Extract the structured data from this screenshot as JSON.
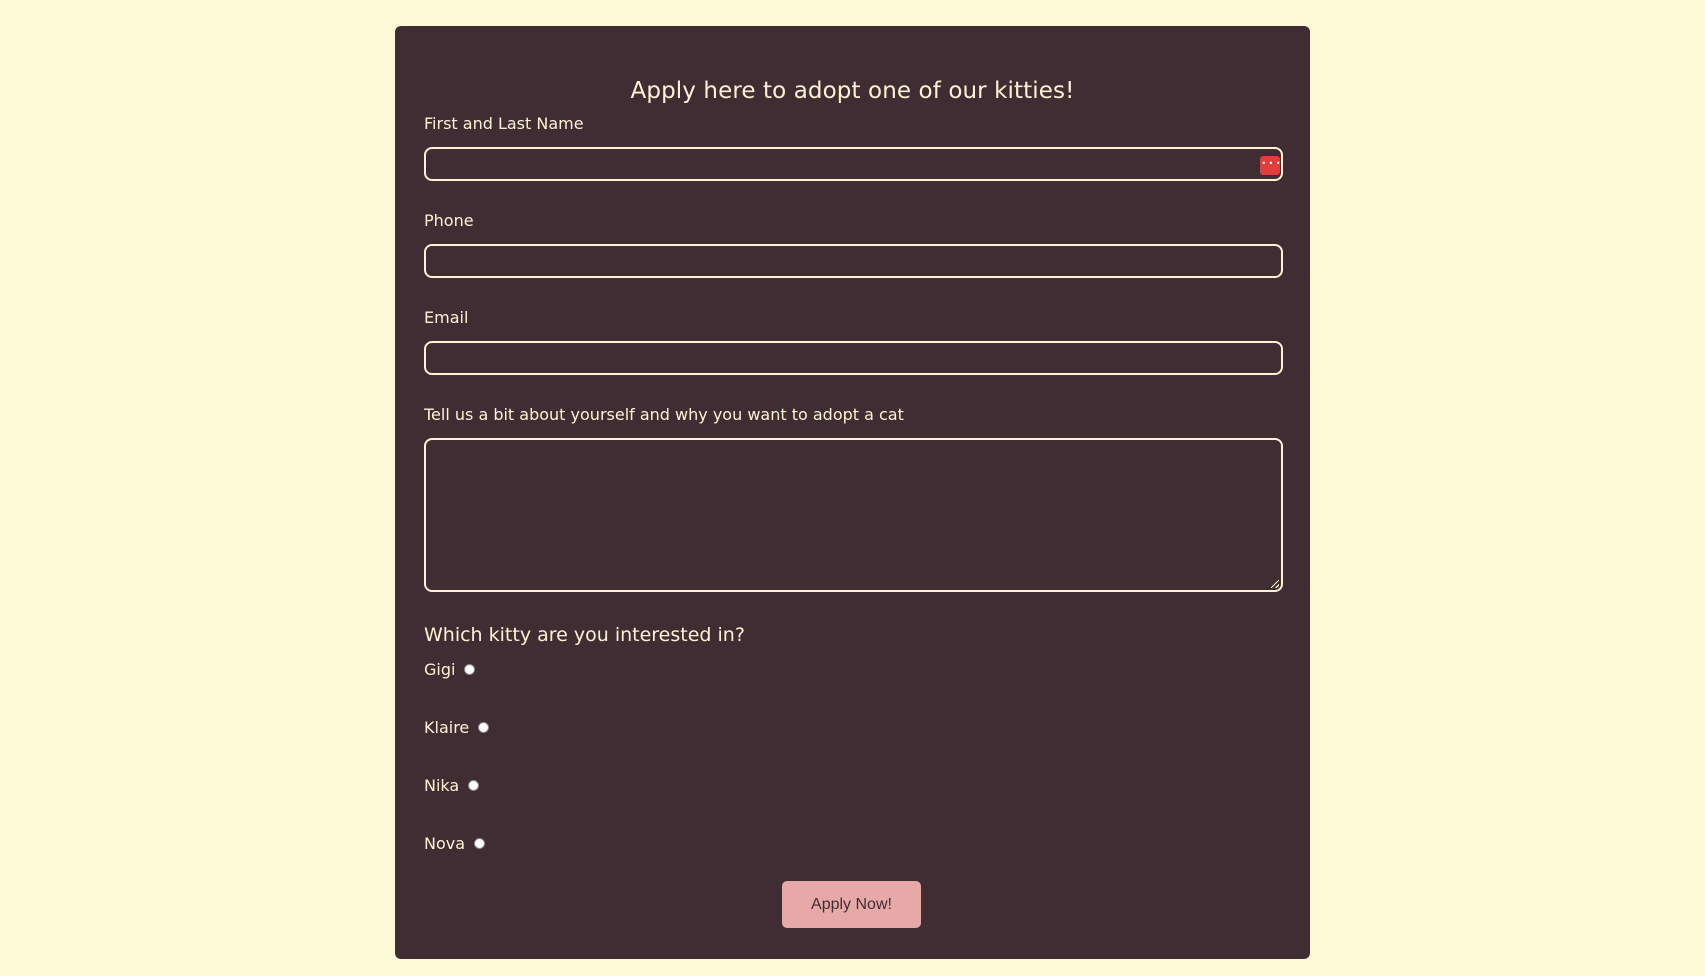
{
  "form": {
    "title": "Apply here to adopt one of our kitties!",
    "fields": {
      "name": {
        "label": "First and Last Name",
        "value": "",
        "placeholder": ""
      },
      "phone": {
        "label": "Phone",
        "value": "",
        "placeholder": ""
      },
      "email": {
        "label": "Email",
        "value": "",
        "placeholder": ""
      },
      "about": {
        "label": "Tell us a bit about yourself and why you want to adopt a cat",
        "value": "",
        "placeholder": ""
      }
    },
    "password_manager_icon": "password-manager-icon",
    "question": "Which kitty are you interested in?",
    "kitties": [
      {
        "label": "Gigi",
        "selected": false
      },
      {
        "label": "Klaire",
        "selected": false
      },
      {
        "label": "Nika",
        "selected": false
      },
      {
        "label": "Nova",
        "selected": false
      }
    ],
    "submit_label": "Apply Now!"
  },
  "colors": {
    "page_background": "#fdf8d6",
    "card_background": "#3f2d33",
    "text": "#fdf3d4",
    "button": "#e7a9a8",
    "password_icon": "#e03d3d"
  }
}
